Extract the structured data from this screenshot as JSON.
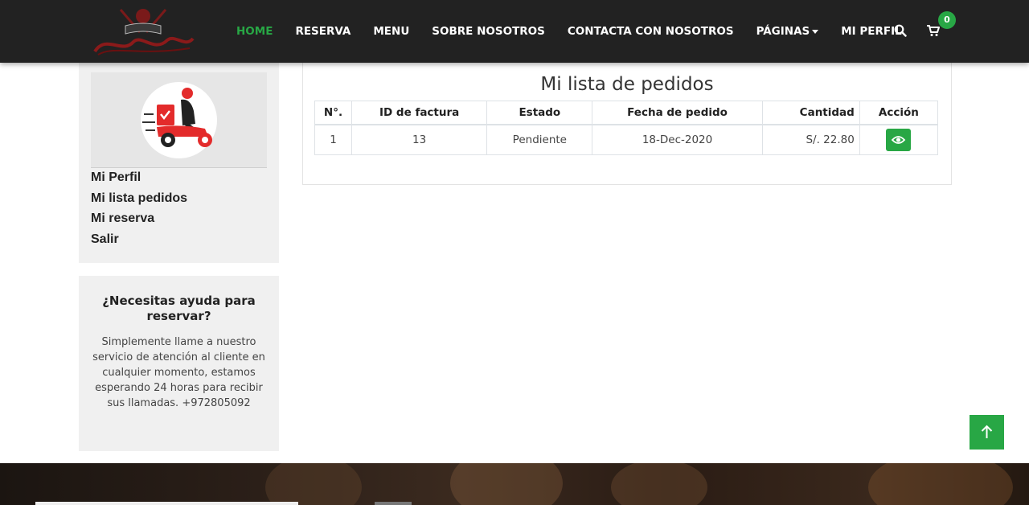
{
  "nav": {
    "logo_icon": "restaurant-logo-icon",
    "links": [
      {
        "label": "HOME",
        "active": true
      },
      {
        "label": "RESERVA"
      },
      {
        "label": "MENU"
      },
      {
        "label": "SOBRE NOSOTROS"
      },
      {
        "label": "CONTACTA CON NOSOTROS"
      },
      {
        "label": "PÁGINAS",
        "dropdown": true
      },
      {
        "label": "MI PERFIL"
      }
    ],
    "search_icon": "search-icon",
    "cart_icon": "cart-icon",
    "cart_count": "0"
  },
  "sidebar": {
    "avatar_icon": "delivery-scooter-icon",
    "menu": [
      "Mi Perfil",
      "Mi lista pedidos",
      "Mi reserva",
      "Salir"
    ],
    "help_title": "¿Necesitas ayuda para reservar?",
    "help_text": "Simplemente llame a nuestro servicio de atención al cliente en cualquier momento, estamos esperando 24 horas para recibir sus llamadas. +972805092"
  },
  "main": {
    "title": "Mi lista de pedidos",
    "columns": [
      "N°.",
      "ID de factura",
      "Estado",
      "Fecha de pedido",
      "Cantidad",
      "Acción"
    ],
    "rows": [
      {
        "no": "1",
        "invoice": "13",
        "status": "Pendiente",
        "date": "18-Dec-2020",
        "amount": "S/. 22.80",
        "action_icon": "eye-icon"
      }
    ]
  },
  "scroll_top_icon": "arrow-up-icon",
  "colors": {
    "accent": "#28a745",
    "navbar": "#222222",
    "sidebar_bg": "#f0f0f0"
  }
}
